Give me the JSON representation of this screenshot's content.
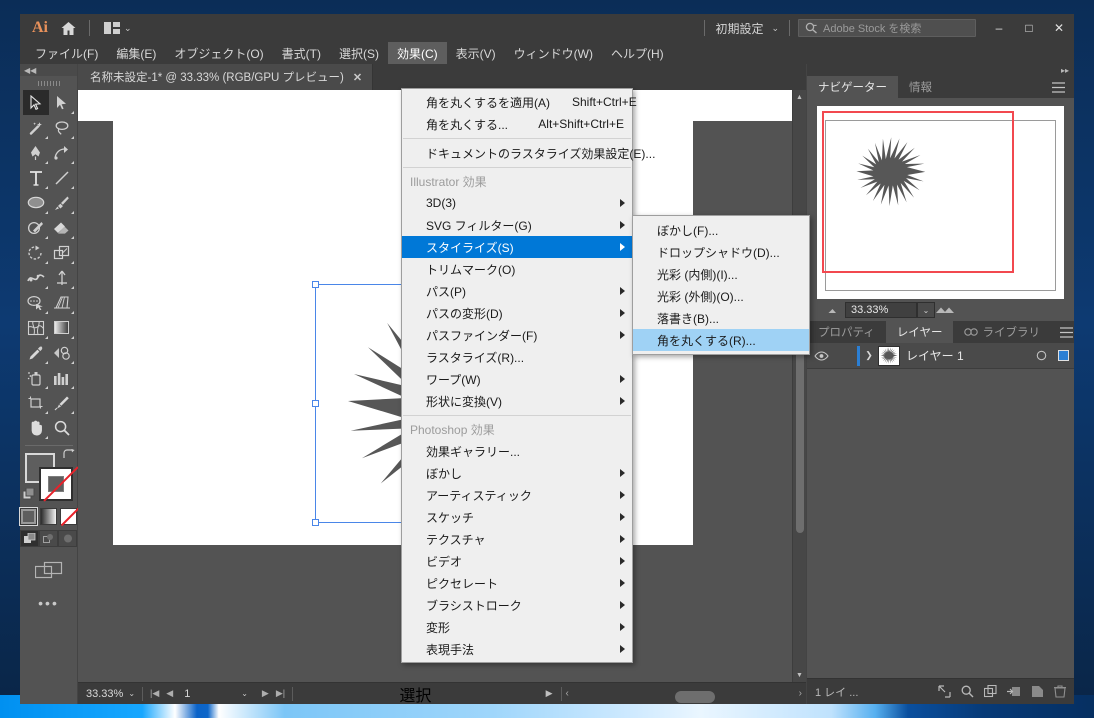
{
  "titlebar": {
    "app_logo": "Ai",
    "home_icon": "home-icon",
    "arrange_icon": "arrange-documents-icon",
    "workspace": "初期設定",
    "workspace_caret": "⌄",
    "search_icon": "search-icon",
    "search_placeholder": "Adobe Stock を検索",
    "minimize": "–",
    "maximize": "□",
    "close": "✕"
  },
  "menubar": {
    "items": [
      {
        "label": "ファイル(F)",
        "active": false
      },
      {
        "label": "編集(E)",
        "active": false
      },
      {
        "label": "オブジェクト(O)",
        "active": false
      },
      {
        "label": "書式(T)",
        "active": false
      },
      {
        "label": "選択(S)",
        "active": false
      },
      {
        "label": "効果(C)",
        "active": true
      },
      {
        "label": "表示(V)",
        "active": false
      },
      {
        "label": "ウィンドウ(W)",
        "active": false
      },
      {
        "label": "ヘルプ(H)",
        "active": false
      }
    ]
  },
  "effect_menu": {
    "rows": [
      {
        "label": "角を丸くするを適用(A)",
        "shortcut": "Shift+Ctrl+E",
        "submenu": false,
        "state": "normal"
      },
      {
        "label": "角を丸くする...",
        "shortcut": "Alt+Shift+Ctrl+E",
        "submenu": false,
        "state": "normal"
      },
      {
        "separator": true
      },
      {
        "label": "ドキュメントのラスタライズ効果設定(E)...",
        "shortcut": "",
        "submenu": false,
        "state": "normal"
      },
      {
        "separator": true
      },
      {
        "label": "Illustrator 効果",
        "shortcut": "",
        "submenu": false,
        "state": "header"
      },
      {
        "label": "3D(3)",
        "shortcut": "",
        "submenu": true,
        "state": "normal"
      },
      {
        "label": "SVG フィルター(G)",
        "shortcut": "",
        "submenu": true,
        "state": "normal"
      },
      {
        "label": "スタイライズ(S)",
        "shortcut": "",
        "submenu": true,
        "state": "highlighted"
      },
      {
        "label": "トリムマーク(O)",
        "shortcut": "",
        "submenu": false,
        "state": "normal"
      },
      {
        "label": "パス(P)",
        "shortcut": "",
        "submenu": true,
        "state": "normal"
      },
      {
        "label": "パスの変形(D)",
        "shortcut": "",
        "submenu": true,
        "state": "normal"
      },
      {
        "label": "パスファインダー(F)",
        "shortcut": "",
        "submenu": true,
        "state": "normal"
      },
      {
        "label": "ラスタライズ(R)...",
        "shortcut": "",
        "submenu": false,
        "state": "normal"
      },
      {
        "label": "ワープ(W)",
        "shortcut": "",
        "submenu": true,
        "state": "normal"
      },
      {
        "label": "形状に変換(V)",
        "shortcut": "",
        "submenu": true,
        "state": "normal"
      },
      {
        "separator": true
      },
      {
        "label": "Photoshop 効果",
        "shortcut": "",
        "submenu": false,
        "state": "header"
      },
      {
        "label": "効果ギャラリー...",
        "shortcut": "",
        "submenu": false,
        "state": "normal"
      },
      {
        "label": "ぼかし",
        "shortcut": "",
        "submenu": true,
        "state": "normal"
      },
      {
        "label": "アーティスティック",
        "shortcut": "",
        "submenu": true,
        "state": "normal"
      },
      {
        "label": "スケッチ",
        "shortcut": "",
        "submenu": true,
        "state": "normal"
      },
      {
        "label": "テクスチャ",
        "shortcut": "",
        "submenu": true,
        "state": "normal"
      },
      {
        "label": "ビデオ",
        "shortcut": "",
        "submenu": true,
        "state": "normal"
      },
      {
        "label": "ピクセレート",
        "shortcut": "",
        "submenu": true,
        "state": "normal"
      },
      {
        "label": "ブラシストローク",
        "shortcut": "",
        "submenu": true,
        "state": "normal"
      },
      {
        "label": "変形",
        "shortcut": "",
        "submenu": true,
        "state": "normal"
      },
      {
        "label": "表現手法",
        "shortcut": "",
        "submenu": true,
        "state": "normal"
      }
    ]
  },
  "stylize_submenu": {
    "rows": [
      {
        "label": "ぼかし(F)...",
        "state": "normal"
      },
      {
        "label": "ドロップシャドウ(D)...",
        "state": "normal"
      },
      {
        "label": "光彩 (内側)(I)...",
        "state": "normal"
      },
      {
        "label": "光彩 (外側)(O)...",
        "state": "normal"
      },
      {
        "label": "落書き(B)...",
        "state": "normal"
      },
      {
        "label": "角を丸くする(R)...",
        "state": "hovered"
      }
    ]
  },
  "document": {
    "tab_title": "名称未設定-1* @ 33.33% (RGB/GPU プレビュー)",
    "tab_close": "✕"
  },
  "canvas": {
    "artwork_name": "22-point-star",
    "artwork_fill": "#575757",
    "selection_color": "#4a86e8"
  },
  "statusbar": {
    "zoom": "33.33%",
    "zoom_caret": "⌄",
    "artboard_first": "|◀",
    "artboard_prev": "◀",
    "artboard_number": "1",
    "artboard_caret": "⌄",
    "artboard_next": "▶",
    "artboard_last": "▶|",
    "status_label": "選択",
    "status_caret": "▶",
    "scroll_left": "‹",
    "scroll_right": "›"
  },
  "dock": {
    "collapse_icon": "collapse-panel-icon",
    "navigator_tabs": [
      {
        "label": "ナビゲーター",
        "selected": true
      },
      {
        "label": "情報",
        "selected": false
      }
    ],
    "navigator_menu_icon": "panel-menu-icon",
    "navigator": {
      "zoom_out_icon": "zoom-out-icon",
      "zoom_value": "33.33%",
      "zoom_caret": "⌄",
      "zoom_in_icon": "zoom-in-icon",
      "view_rect_color": "#f2484f"
    },
    "lower_tabs": [
      {
        "label": "プロパティ",
        "selected": false
      },
      {
        "label": "レイヤー",
        "selected": true
      },
      {
        "label": "CC ライブラリ",
        "selected": false
      }
    ],
    "lower_menu_icon": "panel-menu-icon",
    "layers": {
      "rows": [
        {
          "eye_icon": "eye-icon",
          "expand_icon": "chevron-right-icon",
          "thumbnail": "layer-thumbnail",
          "name": "レイヤー 1",
          "target_icon": "target-circle-icon",
          "color": "#2b7fd4"
        }
      ],
      "footer_count": "1 レイ ...",
      "footer_icons": [
        "locate-object-icon",
        "make-clipping-mask-icon",
        "new-sublayer-icon",
        "new-layer-icon",
        "delete-layer-icon"
      ]
    }
  },
  "toolbar": {
    "collapse_icon": "collapse-toolbar-icon",
    "grip": "drag-grip",
    "tools": [
      {
        "name": "selection-tool",
        "selected": true
      },
      {
        "name": "direct-selection-tool",
        "selected": false
      },
      {
        "name": "magic-wand-tool",
        "selected": false
      },
      {
        "name": "lasso-tool",
        "selected": false
      },
      {
        "name": "pen-tool",
        "selected": false
      },
      {
        "name": "curvature-tool",
        "selected": false
      },
      {
        "name": "type-tool",
        "selected": false
      },
      {
        "name": "line-segment-tool",
        "selected": false
      },
      {
        "name": "ellipse-tool",
        "selected": false
      },
      {
        "name": "paintbrush-tool",
        "selected": false
      },
      {
        "name": "shaper-tool",
        "selected": false
      },
      {
        "name": "eraser-tool",
        "selected": false
      },
      {
        "name": "rotate-tool",
        "selected": false
      },
      {
        "name": "scale-tool",
        "selected": false
      },
      {
        "name": "width-tool",
        "selected": false
      },
      {
        "name": "free-transform-tool",
        "selected": false
      },
      {
        "name": "shape-builder-tool",
        "selected": false
      },
      {
        "name": "perspective-grid-tool",
        "selected": false
      },
      {
        "name": "mesh-tool",
        "selected": false
      },
      {
        "name": "gradient-tool",
        "selected": false
      },
      {
        "name": "eyedropper-tool",
        "selected": false
      },
      {
        "name": "blend-tool",
        "selected": false
      },
      {
        "name": "symbol-sprayer-tool",
        "selected": false
      },
      {
        "name": "column-graph-tool",
        "selected": false
      },
      {
        "name": "artboard-tool",
        "selected": false
      },
      {
        "name": "slice-tool",
        "selected": false
      },
      {
        "name": "hand-tool",
        "selected": false
      },
      {
        "name": "zoom-tool",
        "selected": false
      }
    ],
    "fill_color": "#5e5e5e",
    "stroke_color": "none",
    "swap_icon": "swap-fill-stroke-icon",
    "default_icon": "default-fill-stroke-icon",
    "paint_modes": [
      {
        "name": "color-mode",
        "selected": true
      },
      {
        "name": "gradient-mode",
        "selected": false
      },
      {
        "name": "none-mode",
        "selected": false
      }
    ],
    "draw_modes": [
      {
        "name": "draw-normal-mode",
        "selected": true
      },
      {
        "name": "draw-behind-mode",
        "selected": false
      },
      {
        "name": "draw-inside-mode",
        "selected": false
      }
    ],
    "screen_mode_icon": "change-screen-mode-icon",
    "more_icon": "edit-toolbar-icon"
  }
}
